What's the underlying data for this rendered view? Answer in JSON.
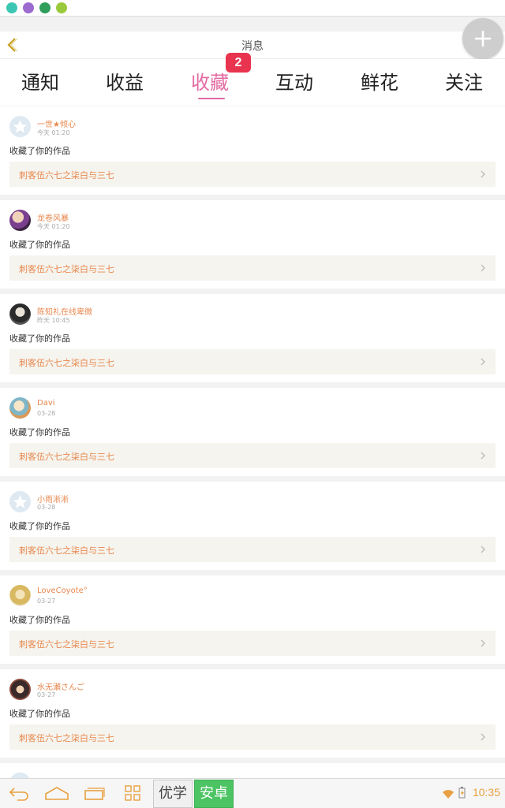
{
  "header": {
    "title": "消息"
  },
  "tabs": [
    {
      "label": "通知",
      "active": false
    },
    {
      "label": "收益",
      "active": false
    },
    {
      "label": "收藏",
      "active": true,
      "badge": "2"
    },
    {
      "label": "互动",
      "active": false
    },
    {
      "label": "鲜花",
      "active": false
    },
    {
      "label": "关注",
      "active": false
    }
  ],
  "items": [
    {
      "user": "一世★倾心",
      "time": "今天 01:20",
      "action": "收藏了你的作品",
      "work": "刺客伍六七之柒白与三七",
      "avatar": "default-star"
    },
    {
      "user": "龙卷风暴",
      "time": "今天 01:20",
      "action": "收藏了你的作品",
      "work": "刺客伍六七之柒白与三七",
      "avatar": "photo"
    },
    {
      "user": "陈知礼在线卑微",
      "time": "昨天 10:45",
      "action": "收藏了你的作品",
      "work": "刺客伍六七之柒白与三七",
      "avatar": "photo"
    },
    {
      "user": "Davi",
      "time": "03-28",
      "action": "收藏了你的作品",
      "work": "刺客伍六七之柒白与三七",
      "avatar": "photo"
    },
    {
      "user": "小雨淅淅",
      "time": "03-28",
      "action": "收藏了你的作品",
      "work": "刺客伍六七之柒白与三七",
      "avatar": "default-star"
    },
    {
      "user": "LoveCoyote°",
      "time": "03-27",
      "action": "收藏了你的作品",
      "work": "刺客伍六七之柒白与三七",
      "avatar": "photo"
    },
    {
      "user": "水无瀬さんご",
      "time": "03-27",
      "action": "收藏了你的作品",
      "work": "刺客伍六七之柒白与三七",
      "avatar": "photo"
    }
  ],
  "navbar": {
    "chip1": "优学",
    "chip2": "安卓",
    "clock": "10:35"
  },
  "colors": {
    "accent": "#e46aa3",
    "badge": "#e8344f",
    "orange": "#e8874d",
    "green": "#4cc463"
  }
}
